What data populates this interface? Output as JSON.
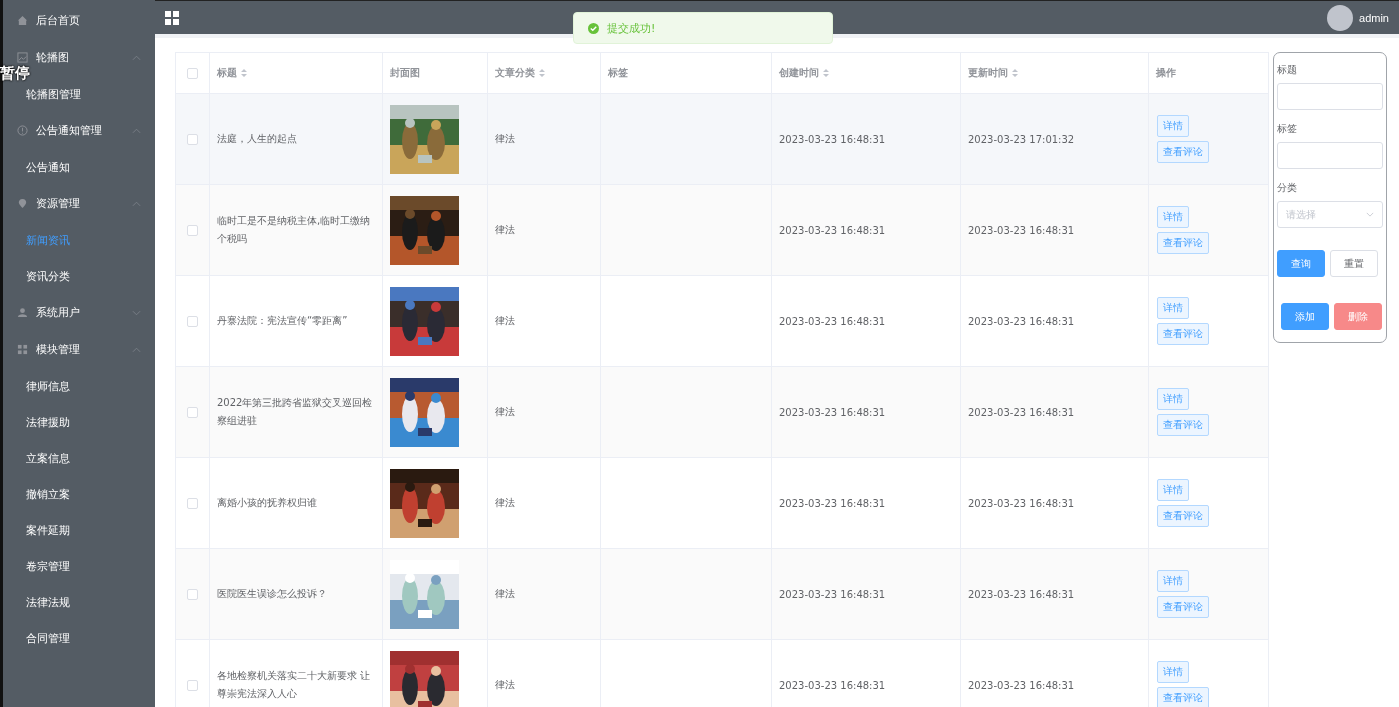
{
  "sidebar": {
    "items": [
      {
        "kind": "link",
        "label": "后台首页",
        "selected": false
      },
      {
        "kind": "menu",
        "label": "轮播图",
        "expanded": true,
        "children": [
          {
            "label": "轮播图管理",
            "selected": false
          }
        ]
      },
      {
        "kind": "menu",
        "label": "公告通知管理",
        "expanded": true,
        "children": [
          {
            "label": "公告通知",
            "selected": false
          }
        ]
      },
      {
        "kind": "menu",
        "label": "资源管理",
        "expanded": true,
        "children": [
          {
            "label": "新闻资讯",
            "selected": true
          },
          {
            "label": "资讯分类",
            "selected": false
          }
        ]
      },
      {
        "kind": "menu",
        "label": "系统用户",
        "expanded": false
      },
      {
        "kind": "menu",
        "label": "模块管理",
        "expanded": true,
        "children": [
          {
            "label": "律师信息",
            "selected": false
          },
          {
            "label": "法律援助",
            "selected": false
          },
          {
            "label": "立案信息",
            "selected": false
          },
          {
            "label": "撤销立案",
            "selected": false
          },
          {
            "label": "案件延期",
            "selected": false
          },
          {
            "label": "卷宗管理",
            "selected": false
          },
          {
            "label": "法律法规",
            "selected": false
          },
          {
            "label": "合同管理",
            "selected": false
          }
        ]
      }
    ]
  },
  "overlay": {
    "text": "暂停"
  },
  "header": {
    "user": "admin"
  },
  "toast": {
    "message": "提交成功!"
  },
  "table": {
    "columns": [
      {
        "label": "标题",
        "sortable": true
      },
      {
        "label": "封面图",
        "sortable": false
      },
      {
        "label": "文章分类",
        "sortable": true
      },
      {
        "label": "标签",
        "sortable": false
      },
      {
        "label": "创建时间",
        "sortable": true
      },
      {
        "label": "更新时间",
        "sortable": true
      },
      {
        "label": "操作",
        "sortable": false
      }
    ],
    "all_checked": false,
    "rows": [
      {
        "title": "法庭，人生的起点",
        "category": "律法",
        "created": "2023-03-23 16:48:31",
        "updated": "2023-03-23 17:01:32",
        "checked": false,
        "actions": [
          "详情",
          "查看评论"
        ]
      },
      {
        "title": "临时工是不是纳税主体,临时工缴纳个税吗",
        "category": "律法",
        "created": "2023-03-23 16:48:31",
        "updated": "2023-03-23 16:48:31",
        "checked": false,
        "actions": [
          "详情",
          "查看评论"
        ]
      },
      {
        "title": "丹寨法院：宪法宣传“零距离”",
        "category": "律法",
        "created": "2023-03-23 16:48:31",
        "updated": "2023-03-23 16:48:31",
        "checked": false,
        "actions": [
          "详情",
          "查看评论"
        ]
      },
      {
        "title": "2022年第三批跨省监狱交叉巡回检察组进驻",
        "category": "律法",
        "created": "2023-03-23 16:48:31",
        "updated": "2023-03-23 16:48:31",
        "checked": false,
        "actions": [
          "详情",
          "查看评论"
        ]
      },
      {
        "title": "离婚小孩的抚养权归谁",
        "category": "律法",
        "created": "2023-03-23 16:48:31",
        "updated": "2023-03-23 16:48:31",
        "checked": false,
        "actions": [
          "详情",
          "查看评论"
        ]
      },
      {
        "title": "医院医生误诊怎么投诉？",
        "category": "律法",
        "created": "2023-03-23 16:48:31",
        "updated": "2023-03-23 16:48:31",
        "checked": false,
        "actions": [
          "详情",
          "查看评论"
        ]
      },
      {
        "title": "各地检察机关落实二十大新要求 让尊崇宪法深入人心",
        "category": "律法",
        "created": "2023-03-23 16:48:31",
        "updated": "2023-03-23 16:48:31",
        "checked": false,
        "actions": [
          "详情",
          "查看评论"
        ]
      }
    ]
  },
  "search_panel": {
    "fields": [
      {
        "kind": "input",
        "label": "标题"
      },
      {
        "kind": "input",
        "label": "标签"
      },
      {
        "kind": "select",
        "label": "分类",
        "placeholder": "请选择"
      }
    ],
    "buttons": [
      {
        "kind": "primary",
        "label": "查询"
      },
      {
        "kind": "plain",
        "label": "重置"
      },
      {
        "kind": "primary",
        "label": "添加"
      },
      {
        "kind": "danger",
        "label": "删除"
      }
    ]
  }
}
